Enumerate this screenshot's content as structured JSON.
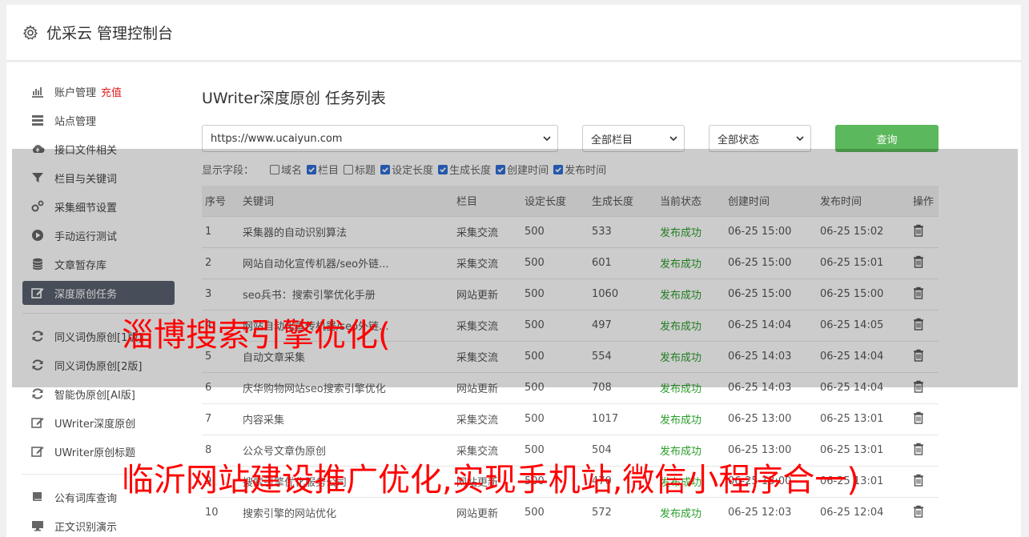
{
  "header": {
    "title": "优采云 管理控制台"
  },
  "sidebar": {
    "groups": [
      [
        {
          "label": "账户管理",
          "badge": "充值",
          "icon": "chart-icon"
        },
        {
          "label": "站点管理",
          "icon": "list-icon"
        },
        {
          "label": "接口文件相关",
          "icon": "cloud-upload-icon"
        },
        {
          "label": "栏目与关键词",
          "icon": "filter-icon"
        },
        {
          "label": "采集细节设置",
          "icon": "gears-icon"
        },
        {
          "label": "手动运行测试",
          "icon": "play-icon"
        },
        {
          "label": "文章暂存库",
          "icon": "database-icon"
        },
        {
          "label": "深度原创任务",
          "icon": "edit-icon",
          "active": true
        }
      ],
      [
        {
          "label": "同义词伪原创[1版]",
          "icon": "refresh-icon"
        },
        {
          "label": "同义词伪原创[2版]",
          "icon": "refresh-icon"
        },
        {
          "label": "智能伪原创[AI版]",
          "icon": "refresh-icon"
        },
        {
          "label": "UWriter深度原创",
          "icon": "edit-icon"
        },
        {
          "label": "UWriter原创标题",
          "icon": "edit-icon"
        }
      ],
      [
        {
          "label": "公有词库查询",
          "icon": "book-icon"
        },
        {
          "label": "正文识别演示",
          "icon": "monitor-icon"
        }
      ]
    ]
  },
  "main": {
    "title": "UWriter深度原创 任务列表",
    "site_select": "https://www.ucaiyun.com",
    "column_select": "全部栏目",
    "status_select": "全部状态",
    "query_label": "查询",
    "fields_label": "显示字段：",
    "fields": [
      {
        "label": "域名",
        "checked": false
      },
      {
        "label": "栏目",
        "checked": true
      },
      {
        "label": "标题",
        "checked": false
      },
      {
        "label": "设定长度",
        "checked": true
      },
      {
        "label": "生成长度",
        "checked": true
      },
      {
        "label": "创建时间",
        "checked": true
      },
      {
        "label": "发布时间",
        "checked": true
      }
    ],
    "columns": [
      "序号",
      "关键词",
      "栏目",
      "设定长度",
      "生成长度",
      "当前状态",
      "创建时间",
      "发布时间",
      "操作"
    ],
    "rows": [
      [
        "1",
        "采集器的自动识别算法",
        "采集交流",
        "500",
        "533",
        "发布成功",
        "06-25 15:00",
        "06-25 15:02"
      ],
      [
        "2",
        "网站自动化宣传机器/seo外链...",
        "采集交流",
        "500",
        "601",
        "发布成功",
        "06-25 15:00",
        "06-25 15:01"
      ],
      [
        "3",
        "seo兵书：搜索引擎优化手册",
        "网站更新",
        "500",
        "1060",
        "发布成功",
        "06-25 15:00",
        "06-25 15:00"
      ],
      [
        "4",
        "网站自动化宣传机器/seo外链...",
        "采集交流",
        "500",
        "497",
        "发布成功",
        "06-25 14:04",
        "06-25 14:05"
      ],
      [
        "5",
        "自动文章采集",
        "采集交流",
        "500",
        "554",
        "发布成功",
        "06-25 14:03",
        "06-25 14:04"
      ],
      [
        "6",
        "庆华购物网站seo搜索引擎优化",
        "网站更新",
        "500",
        "708",
        "发布成功",
        "06-25 14:03",
        "06-25 14:04"
      ],
      [
        "7",
        "内容采集",
        "采集交流",
        "500",
        "1017",
        "发布成功",
        "06-25 13:00",
        "06-25 13:01"
      ],
      [
        "8",
        "公众号文章伪原创",
        "采集交流",
        "500",
        "504",
        "发布成功",
        "06-25 13:00",
        "06-25 13:01"
      ],
      [
        "9",
        "搜索引擎优化服务公司",
        "网站更新",
        "500",
        "470",
        "发布成功",
        "06-25 13:00",
        "06-25 13:01"
      ],
      [
        "10",
        "搜索引擎的网站优化",
        "网站更新",
        "500",
        "572",
        "发布成功",
        "06-25 12:03",
        "06-25 12:04"
      ]
    ]
  },
  "watermarks": {
    "line1": "淄博搜索引擎优化(",
    "line2": "临沂网站建设推广优化,实现手机站,微信小程序合一)"
  }
}
